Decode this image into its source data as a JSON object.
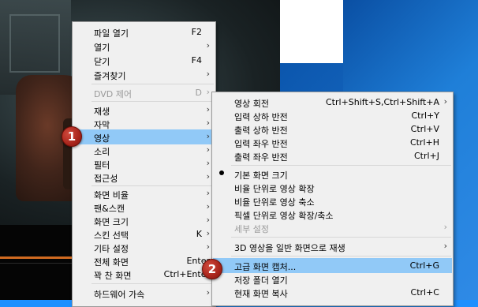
{
  "main_menu": {
    "items": [
      {
        "label": "파일 열기",
        "shortcut": "F2",
        "submenu": false
      },
      {
        "label": "열기",
        "shortcut": "",
        "submenu": true
      },
      {
        "label": "닫기",
        "shortcut": "F4",
        "submenu": false
      },
      {
        "label": "즐겨찾기",
        "shortcut": "",
        "submenu": true
      },
      {
        "label": "DVD 제어",
        "shortcut": "D",
        "submenu": true,
        "disabled": true
      },
      {
        "label": "재생",
        "shortcut": "",
        "submenu": true
      },
      {
        "label": "자막",
        "shortcut": "",
        "submenu": true
      },
      {
        "label": "영상",
        "shortcut": "",
        "submenu": true,
        "highlighted": true
      },
      {
        "label": "소리",
        "shortcut": "",
        "submenu": true
      },
      {
        "label": "필터",
        "shortcut": "",
        "submenu": true
      },
      {
        "label": "접근성",
        "shortcut": "",
        "submenu": true
      },
      {
        "label": "화면 비율",
        "shortcut": "",
        "submenu": true
      },
      {
        "label": "팬&스캔",
        "shortcut": "",
        "submenu": true
      },
      {
        "label": "화면 크기",
        "shortcut": "",
        "submenu": true
      },
      {
        "label": "스킨 선택",
        "shortcut": "K",
        "submenu": true
      },
      {
        "label": "기타 설정",
        "shortcut": "",
        "submenu": true
      },
      {
        "label": "전체 화면",
        "shortcut": "Enter",
        "submenu": false
      },
      {
        "label": "꽉 찬 화면",
        "shortcut": "Ctrl+Enter",
        "submenu": false
      },
      {
        "label": "하드웨어 가속",
        "shortcut": "",
        "submenu": true
      }
    ]
  },
  "video_submenu": {
    "items": [
      {
        "label": "영상 회전",
        "shortcut": "Ctrl+Shift+S,Ctrl+Shift+A",
        "submenu": true
      },
      {
        "label": "입력 상하 반전",
        "shortcut": "Ctrl+Y"
      },
      {
        "label": "출력 상하 반전",
        "shortcut": "Ctrl+V"
      },
      {
        "label": "입력 좌우 반전",
        "shortcut": "Ctrl+H"
      },
      {
        "label": "출력 좌우 반전",
        "shortcut": "Ctrl+J"
      },
      {
        "label": "기본 화면 크기",
        "shortcut": "",
        "checked": true
      },
      {
        "label": "비율 단위로 영상 확장",
        "shortcut": ""
      },
      {
        "label": "비율 단위로 영상 축소",
        "shortcut": ""
      },
      {
        "label": "픽셀 단위로 영상 확장/축소",
        "shortcut": ""
      },
      {
        "label": "세부 설정",
        "shortcut": "",
        "submenu": true,
        "disabled": true
      },
      {
        "label": "3D 영상을 일반 화면으로 재생",
        "shortcut": "",
        "submenu": true
      },
      {
        "label": "고급 화면 캡처...",
        "shortcut": "Ctrl+G",
        "highlighted": true
      },
      {
        "label": "저장 폴더 열기",
        "shortcut": ""
      },
      {
        "label": "현재 화면 복사",
        "shortcut": "Ctrl+C"
      }
    ]
  },
  "badges": {
    "step1": "1",
    "step2": "2"
  },
  "colors": {
    "highlight": "#91c9f7",
    "menu_bg": "#f0f0f0",
    "badge": "#b02a1f",
    "seekbar": "#d06a20"
  }
}
